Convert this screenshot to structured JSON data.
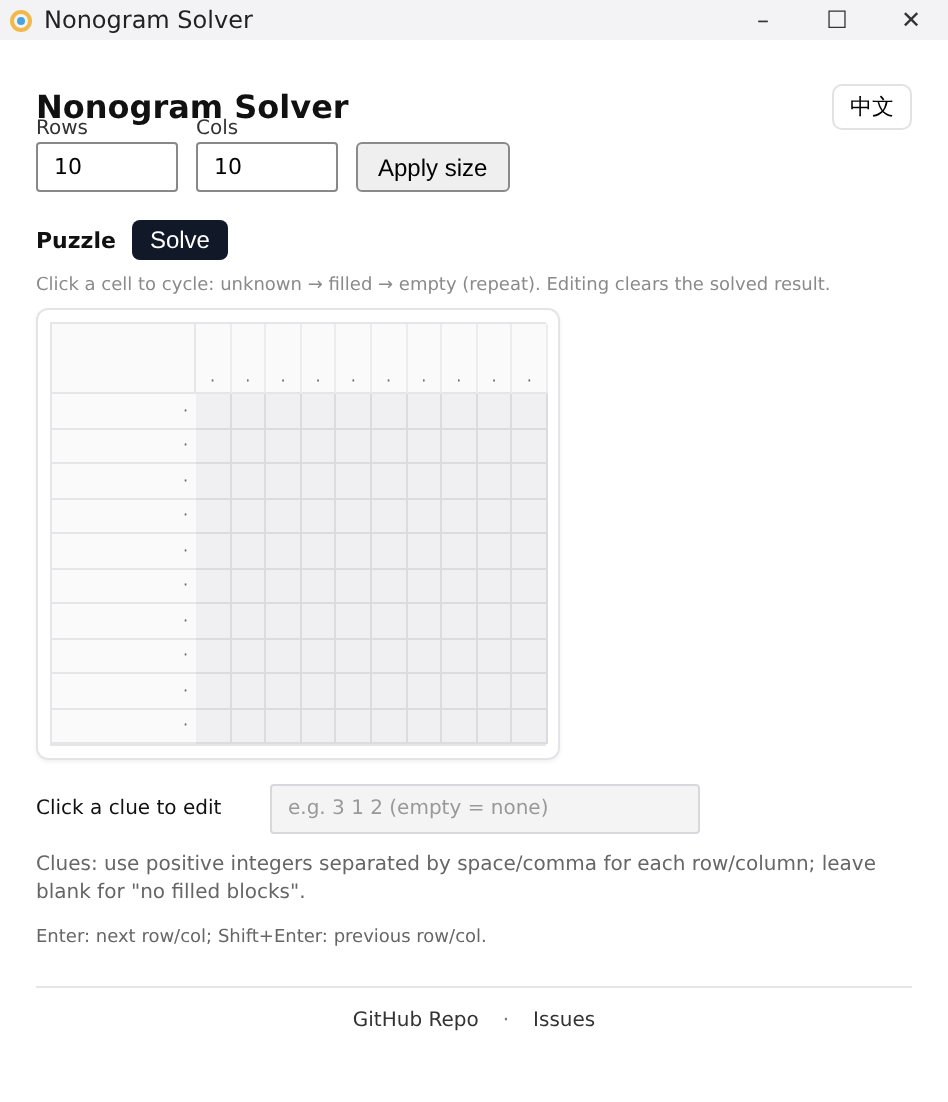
{
  "window": {
    "title": "Nonogram Solver",
    "controls": [
      "–",
      "☐",
      "✕"
    ]
  },
  "header": {
    "title": "Nonogram Solver",
    "language_button": "中文"
  },
  "size": {
    "rows_label": "Rows",
    "rows_value": "10",
    "cols_label": "Cols",
    "cols_value": "10",
    "apply_button": "Apply size"
  },
  "puzzle": {
    "heading": "Puzzle",
    "solve_button": "Solve",
    "hint": "Click a cell to cycle: unknown → filled → empty (repeat). Editing clears the solved result.",
    "column_clues": [
      "·",
      "·",
      "·",
      "·",
      "·",
      "·",
      "·",
      "·",
      "·",
      "·"
    ],
    "row_clues": [
      "·",
      "·",
      "·",
      "·",
      "·",
      "·",
      "·",
      "·",
      "·",
      "·"
    ],
    "cells": [
      [
        {
          "unknown": true
        },
        {
          "unknown": true
        },
        {
          "unknown": true
        },
        {
          "unknown": true
        },
        {
          "unknown": true
        },
        {
          "unknown": true
        },
        {
          "unknown": true
        },
        {
          "unknown": true
        },
        {
          "unknown": true
        },
        {
          "unknown": true
        }
      ],
      [
        {
          "unknown": true
        },
        {
          "unknown": true
        },
        {
          "unknown": true
        },
        {
          "unknown": true
        },
        {
          "unknown": true
        },
        {
          "unknown": true
        },
        {
          "unknown": true
        },
        {
          "unknown": true
        },
        {
          "unknown": true
        },
        {
          "unknown": true
        }
      ],
      [
        {
          "unknown": true
        },
        {
          "unknown": true
        },
        {
          "unknown": true
        },
        {
          "unknown": true
        },
        {
          "unknown": true
        },
        {
          "unknown": true
        },
        {
          "unknown": true
        },
        {
          "unknown": true
        },
        {
          "unknown": true
        },
        {
          "unknown": true
        }
      ],
      [
        {
          "unknown": true
        },
        {
          "unknown": true
        },
        {
          "unknown": true
        },
        {
          "unknown": true
        },
        {
          "unknown": true
        },
        {
          "unknown": true
        },
        {
          "unknown": true
        },
        {
          "unknown": true
        },
        {
          "unknown": true
        },
        {
          "unknown": true
        }
      ],
      [
        {
          "unknown": true
        },
        {
          "unknown": true
        },
        {
          "unknown": true
        },
        {
          "unknown": true
        },
        {
          "unknown": true
        },
        {
          "unknown": true
        },
        {
          "unknown": true
        },
        {
          "unknown": true
        },
        {
          "unknown": true
        },
        {
          "unknown": true
        }
      ],
      [
        {
          "unknown": true
        },
        {
          "unknown": true
        },
        {
          "unknown": true
        },
        {
          "unknown": true
        },
        {
          "unknown": true
        },
        {
          "unknown": true
        },
        {
          "unknown": true
        },
        {
          "unknown": true
        },
        {
          "unknown": true
        },
        {
          "unknown": true
        }
      ],
      [
        {
          "unknown": true
        },
        {
          "unknown": true
        },
        {
          "unknown": true
        },
        {
          "unknown": true
        },
        {
          "unknown": true
        },
        {
          "unknown": true
        },
        {
          "unknown": true
        },
        {
          "unknown": true
        },
        {
          "unknown": true
        },
        {
          "unknown": true
        }
      ],
      [
        {
          "unknown": true
        },
        {
          "unknown": true
        },
        {
          "unknown": true
        },
        {
          "unknown": true
        },
        {
          "unknown": true
        },
        {
          "unknown": true
        },
        {
          "unknown": true
        },
        {
          "unknown": true
        },
        {
          "unknown": true
        },
        {
          "unknown": true
        }
      ],
      [
        {
          "unknown": true
        },
        {
          "unknown": true
        },
        {
          "unknown": true
        },
        {
          "unknown": true
        },
        {
          "unknown": true
        },
        {
          "unknown": true
        },
        {
          "unknown": true
        },
        {
          "unknown": true
        },
        {
          "unknown": true
        },
        {
          "unknown": true
        }
      ],
      [
        {
          "unknown": true
        },
        {
          "unknown": true
        },
        {
          "unknown": true
        },
        {
          "unknown": true
        },
        {
          "unknown": true
        },
        {
          "unknown": true
        },
        {
          "unknown": true
        },
        {
          "unknown": true
        },
        {
          "unknown": true
        },
        {
          "unknown": true
        }
      ]
    ]
  },
  "clue_editor": {
    "label": "Click a clue to edit",
    "placeholder": "e.g. 3 1 2 (empty = none)"
  },
  "notes": [
    "Clues: use positive integers separated by space/comma for each row/column; leave blank for \"no filled blocks\".",
    "Enter: next row/col; Shift+Enter: previous row/col."
  ],
  "footer": {
    "links": [
      "GitHub Repo",
      "Issues"
    ],
    "separator": "·"
  }
}
